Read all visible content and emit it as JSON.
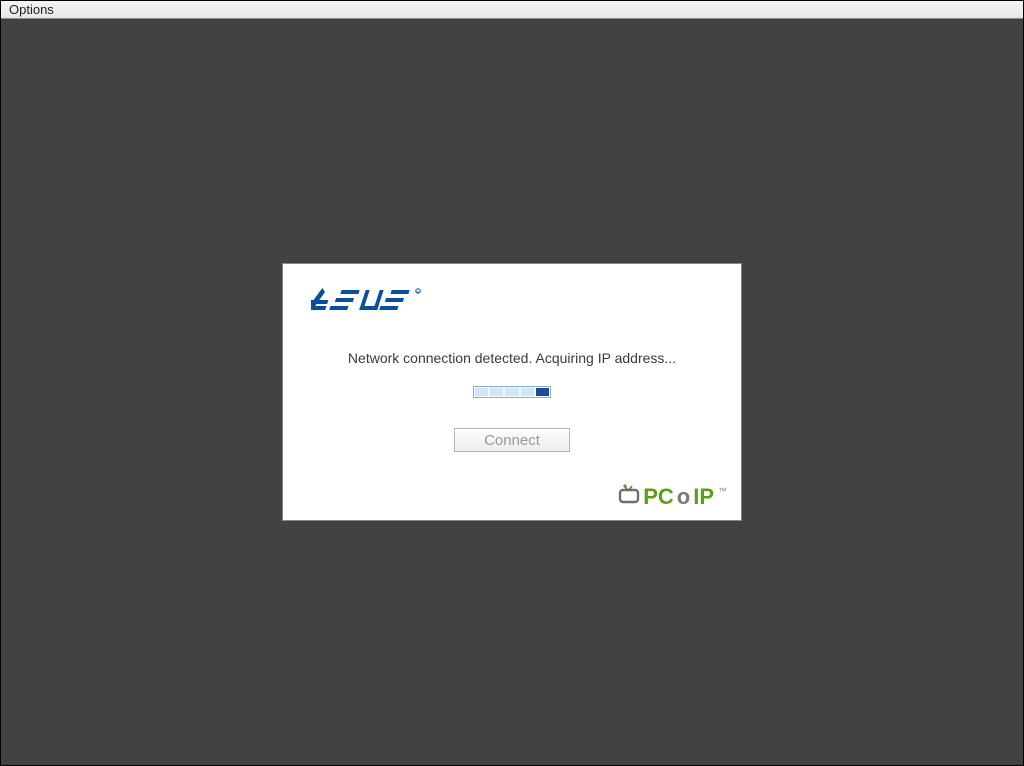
{
  "menubar": {
    "options_label": "Options"
  },
  "dialog": {
    "status_text": "Network connection detected. Acquiring IP address...",
    "connect_label": "Connect"
  },
  "logos": {
    "asus": "ASUS",
    "pcoip_pc": "PC",
    "pcoip_o": "o",
    "pcoip_ip": "IP",
    "pcoip_tm": "™"
  }
}
